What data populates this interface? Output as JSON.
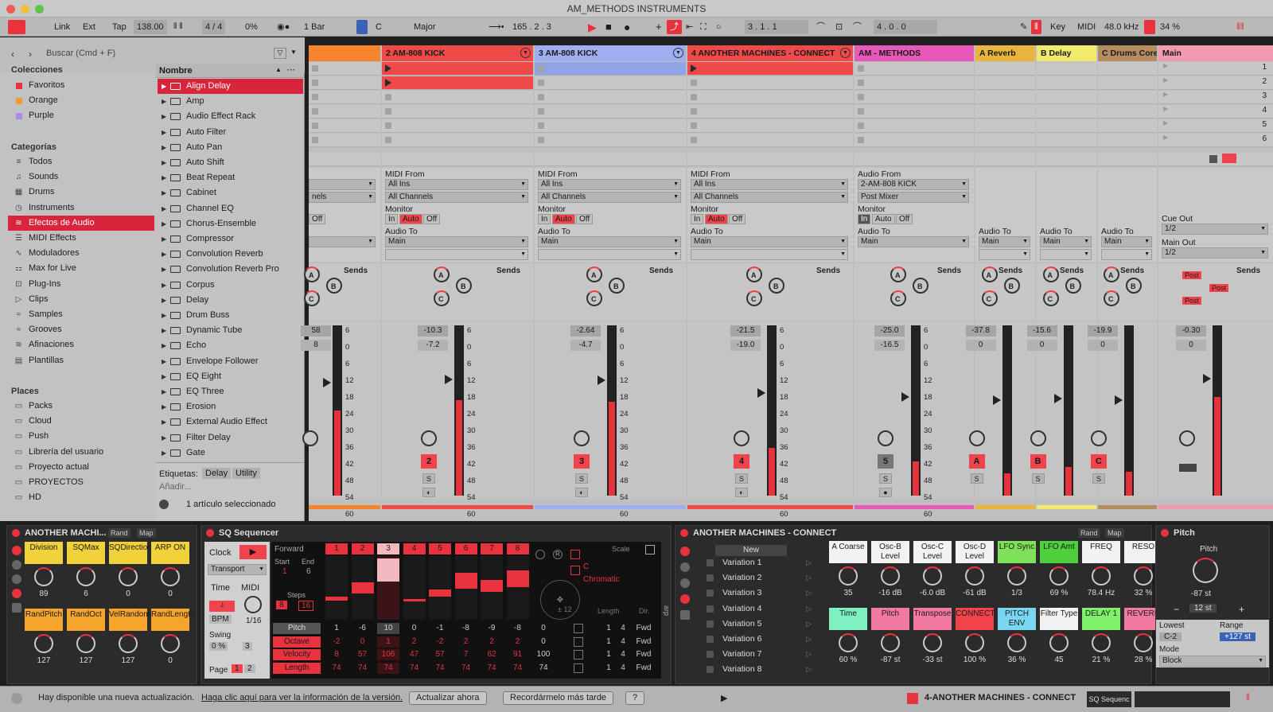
{
  "window": {
    "title": "AM_METHODS INSTRUMENTS"
  },
  "transport": {
    "link": "Link",
    "ext": "Ext",
    "tap": "Tap",
    "tempo": "138.00",
    "signature": "4 / 4",
    "groove": "0%",
    "quantize": "1 Bar",
    "key": "C",
    "scale": "Major",
    "position": "165 .  2 .  3",
    "loop_start": "3 .  1 .  1",
    "loop_length": "4 .  0 .  0",
    "key_label": "Key",
    "midi_label": "MIDI",
    "sample_rate": "48.0 kHz",
    "cpu": "34 %"
  },
  "browser": {
    "search_placeholder": "Buscar (Cmd + F)",
    "collections_title": "Colecciones",
    "collections": [
      {
        "label": "Favoritos",
        "color": "#e8323d"
      },
      {
        "label": "Orange",
        "color": "#f29a38"
      },
      {
        "label": "Purple",
        "color": "#a78be6"
      }
    ],
    "categories_title": "Categorías",
    "categories": [
      "Todos",
      "Sounds",
      "Drums",
      "Instruments",
      "Efectos de Audio",
      "MIDI Effects",
      "Moduladores",
      "Max for Live",
      "Plug-Ins",
      "Clips",
      "Samples",
      "Grooves",
      "Afinaciones",
      "Plantillas"
    ],
    "category_icons": [
      "≡",
      "♫",
      "▦",
      "◷",
      "≋",
      "☰",
      "∿",
      "⚏",
      "⊡",
      "▷",
      "≈",
      "≈",
      "≋",
      "▤"
    ],
    "places_title": "Places",
    "places": [
      "Packs",
      "Cloud",
      "Push",
      "Librería del usuario",
      "Proyecto actual",
      "PROYECTOS",
      "HD"
    ],
    "column_header": "Nombre",
    "items": [
      "Align Delay",
      "Amp",
      "Audio Effect Rack",
      "Auto Filter",
      "Auto Pan",
      "Auto Shift",
      "Beat Repeat",
      "Cabinet",
      "Channel EQ",
      "Chorus-Ensemble",
      "Compressor",
      "Convolution Reverb",
      "Convolution Reverb Pro",
      "Corpus",
      "Delay",
      "Drum Buss",
      "Dynamic Tube",
      "Echo",
      "Envelope Follower",
      "EQ Eight",
      "EQ Three",
      "Erosion",
      "External Audio Effect",
      "Filter Delay",
      "Gate"
    ],
    "tags_label": "Etiquetas:",
    "tags": [
      "Delay",
      "Utility"
    ],
    "add_label": "Añadir...",
    "selection_info": "1 artículo seleccionado"
  },
  "session": {
    "tracks": [
      {
        "name": "",
        "color": "#f5842c"
      },
      {
        "name": "2 AM-808 KICK",
        "color": "#ef4a4a"
      },
      {
        "name": "3 AM-808 KICK",
        "color": "#9eaef0"
      },
      {
        "name": "4 ANOTHER MACHINES - CONNECT",
        "color": "#ef4a4a"
      },
      {
        "name": "AM - METHODS",
        "color": "#e759b8"
      },
      {
        "name": "A Reverb",
        "color": "#e9b53e"
      },
      {
        "name": "B Delay",
        "color": "#f2ea6a"
      },
      {
        "name": "C Drums Core",
        "color": "#b58b60"
      },
      {
        "name": "Main",
        "color": "#f29ab0"
      }
    ],
    "scenes": [
      "1",
      "2",
      "3",
      "4",
      "5",
      "6"
    ],
    "io": {
      "midi_from": "MIDI From",
      "all_ins": "All Ins",
      "all_channels": "All Channels",
      "channels_partial": "nels",
      "monitor": "Monitor",
      "in": "In",
      "auto": "Auto",
      "off": "Off",
      "audio_to": "Audio To",
      "main": "Main",
      "audio_from": "Audio From",
      "audio_from_value": "2-AM-808 KICK",
      "post_mixer": "Post Mixer",
      "cue_out": "Cue Out",
      "cue_value": "1/2",
      "main_out": "Main Out",
      "main_out_value": "1/2"
    },
    "sends_label": "Sends",
    "post_label": "Post",
    "volumes": [
      {
        "a": "58",
        "b": "8"
      },
      {
        "a": "-10.3",
        "b": "-7.2"
      },
      {
        "a": "-2.64",
        "b": "-4.7"
      },
      {
        "a": "-21.5",
        "b": "-19.0"
      },
      {
        "a": "-25.0",
        "b": "-16.5"
      },
      {
        "a": "-37.8",
        "b": "0"
      },
      {
        "a": "-15.6",
        "b": "0"
      },
      {
        "a": "-19.9",
        "b": "0"
      },
      {
        "a": "-0.30",
        "b": "0"
      }
    ],
    "meter_levels": [
      0.5,
      0.56,
      0.55,
      0.28,
      0.2,
      0.13,
      0.17,
      0.14,
      0.58
    ],
    "scale_marks": [
      "6",
      "0",
      "6",
      "12",
      "18",
      "24",
      "30",
      "36",
      "42",
      "48",
      "54",
      "60"
    ],
    "track_numbers": [
      "",
      "2",
      "3",
      "4",
      "5",
      "A",
      "B",
      "C",
      ""
    ],
    "solo": "S"
  },
  "devices": {
    "rack": {
      "title": "ANOTHER MACHI...",
      "rand": "Rand",
      "map": "Map",
      "macros": [
        {
          "label": "Division",
          "value": "89",
          "color": "#f2d23a"
        },
        {
          "label": "SQMax",
          "value": "6",
          "color": "#f2d23a"
        },
        {
          "label": "SQDirection",
          "value": "0",
          "color": "#f2d23a"
        },
        {
          "label": "ARP ON",
          "value": "0",
          "color": "#f2d23a"
        },
        {
          "label": "RandPitch",
          "value": "127",
          "color": "#f5a52c"
        },
        {
          "label": "RandOct",
          "value": "127",
          "color": "#f5a52c"
        },
        {
          "label": "VelRandom",
          "value": "127",
          "color": "#f5a52c"
        },
        {
          "label": "RandLength",
          "value": "0",
          "color": "#f5a52c"
        }
      ]
    },
    "sq": {
      "title": "SQ Sequencer",
      "clock": "Clock",
      "transport": "Transport",
      "time": "Time",
      "midi": "MIDI",
      "bpm": "BPM",
      "swing": "Swing",
      "swing_value": "0 %",
      "division": "1/16",
      "swing_num": "3",
      "page": "Page",
      "pages": [
        "1",
        "2"
      ],
      "direction": "Forward",
      "start": "Start",
      "end": "End",
      "start_value": "1",
      "end_value": "6",
      "steps_label": "Steps",
      "steps": [
        "8",
        "16"
      ],
      "step_numbers": [
        "1",
        "2",
        "3",
        "4",
        "5",
        "6",
        "7",
        "8"
      ],
      "step_bars": [
        0.15,
        0.45,
        0.95,
        0.1,
        0.3,
        0.65,
        0.5,
        0.7
      ],
      "rows": [
        {
          "label": "Pitch",
          "values": [
            "1",
            "-6",
            "10",
            "0",
            "-1",
            "-8",
            "-9",
            "-8"
          ]
        },
        {
          "label": "Octave",
          "values": [
            "-2",
            "0",
            "1",
            "2",
            "-2",
            "2",
            "2",
            "2"
          ]
        },
        {
          "label": "Velocity",
          "values": [
            "8",
            "57",
            "106",
            "47",
            "57",
            "7",
            "62",
            "91"
          ]
        },
        {
          "label": "Length",
          "values": [
            "74",
            "74",
            "74",
            "74",
            "74",
            "74",
            "74",
            "74"
          ]
        }
      ],
      "row_extra": [
        {
          "a": "0",
          "b": "1",
          "c": "4",
          "d": "Fwd"
        },
        {
          "a": "0",
          "b": "1",
          "c": "4",
          "d": "Fwd"
        },
        {
          "a": "100",
          "b": "1",
          "c": "4",
          "d": "Fwd"
        },
        {
          "a": "74",
          "b": "1",
          "c": "4",
          "d": "Fwd"
        }
      ],
      "scale_label": "Scale",
      "scale_key": "C",
      "scale_mode": "Chromatic",
      "plusminus": "± 12",
      "length_label": "Length",
      "dir_label": "Dir.",
      "arp_label": "arp"
    },
    "instrument": {
      "title": "ANOTHER MACHINES - CONNECT",
      "rand": "Rand",
      "map": "Map",
      "new": "New",
      "variations": [
        "Variation 1",
        "Variation 2",
        "Variation 3",
        "Variation 4",
        "Variation 5",
        "Variation 6",
        "Variation 7",
        "Variation 8"
      ],
      "params_top": [
        {
          "label": "A Coarse",
          "value": "35",
          "color": "#f2f2f2"
        },
        {
          "label": "Osc-B Level",
          "value": "-16 dB",
          "color": "#f2f2f2"
        },
        {
          "label": "Osc-C Level",
          "value": "-6.0 dB",
          "color": "#f2f2f2"
        },
        {
          "label": "Osc-D Level",
          "value": "-61 dB",
          "color": "#f2f2f2"
        },
        {
          "label": "LFO Sync",
          "value": "1/3",
          "color": "#7fe05a"
        },
        {
          "label": "LFO Amt",
          "value": "69 %",
          "color": "#4ecf3e"
        },
        {
          "label": "FREQ",
          "value": "78.4 Hz",
          "color": "#f2f2f2"
        },
        {
          "label": "RESO",
          "value": "32 %",
          "color": "#f2f2f2"
        }
      ],
      "params_bottom": [
        {
          "label": "Time",
          "value": "60 %",
          "color": "#7ef0c2"
        },
        {
          "label": "Pitch",
          "value": "-87 st",
          "color": "#f27aa0"
        },
        {
          "label": "Transpose",
          "value": "-33 st",
          "color": "#f27aa0"
        },
        {
          "label": "CONNECT",
          "value": "100 %",
          "color": "#f2434b"
        },
        {
          "label": "PITCH ENV",
          "value": "36 %",
          "color": "#7ad6f0"
        },
        {
          "label": "Filter Type",
          "value": "45",
          "color": "#f2f2f2"
        },
        {
          "label": "DELAY 1",
          "value": "21 %",
          "color": "#7ef06a"
        },
        {
          "label": "REVERB",
          "value": "28 %",
          "color": "#f27aa0"
        }
      ]
    },
    "pitch": {
      "title": "Pitch",
      "label": "Pitch",
      "value": "-87 st",
      "range_value": "12 st",
      "lowest_label": "Lowest",
      "range_label": "Range",
      "lowest": "C-2",
      "range": "+127 st",
      "mode_label": "Mode",
      "mode": "Block"
    }
  },
  "status": {
    "message": "Hay disponible una nueva actualización.",
    "link": "Haga clic aquí para ver la información de la versión.",
    "update_now": "Actualizar ahora",
    "remind_later": "Recordármelo más tarde",
    "help": "?",
    "track": "4-ANOTHER MACHINES - CONNECT",
    "device": "SQ Sequenc"
  }
}
